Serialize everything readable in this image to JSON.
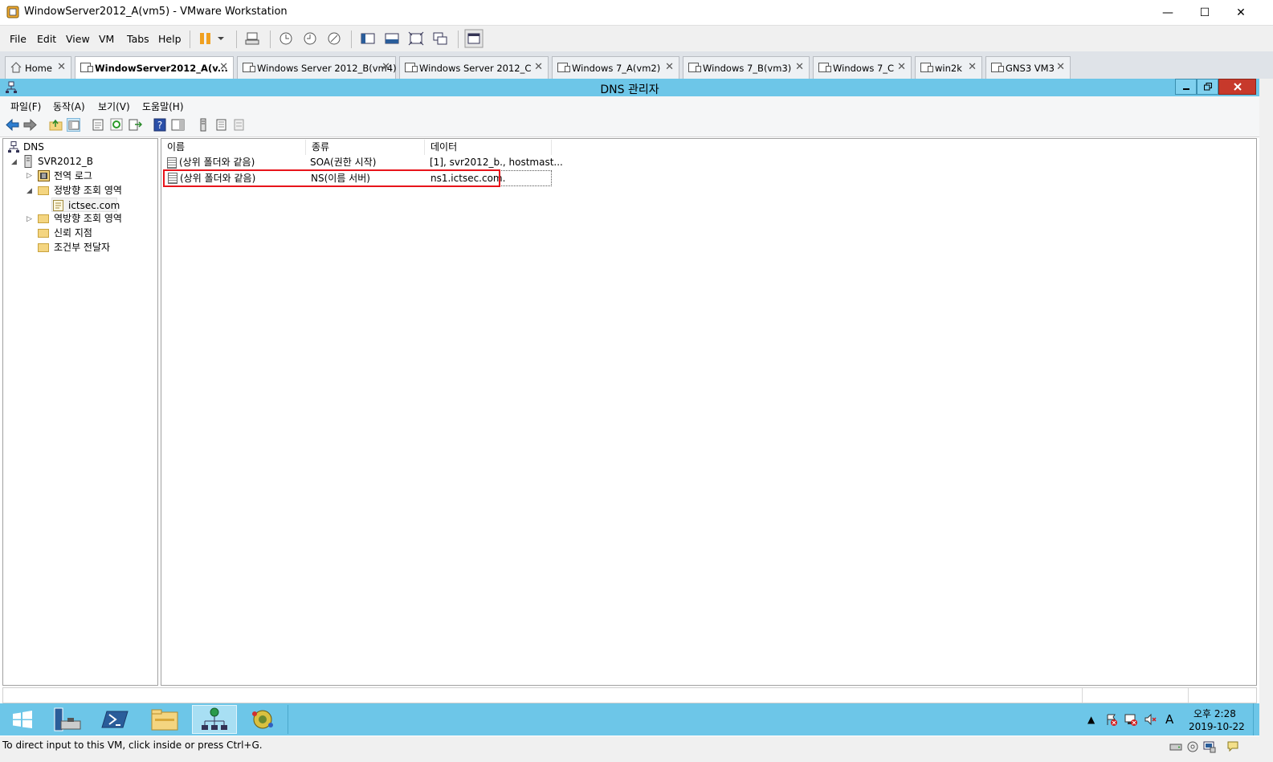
{
  "vmware": {
    "title": "WindowServer2012_A(vm5) - VMware Workstation",
    "window_controls": {
      "minimize": "—",
      "maximize": "☐",
      "close": "✕"
    },
    "menu": [
      "File",
      "Edit",
      "View",
      "VM",
      "Tabs",
      "Help"
    ],
    "tabs": [
      {
        "label": "Home",
        "icon": "home-icon"
      },
      {
        "label": "WindowServer2012_A(v...",
        "active": true
      },
      {
        "label": "Windows Server 2012_B(vm4)"
      },
      {
        "label": "Windows Server 2012_C"
      },
      {
        "label": "Windows 7_A(vm2)"
      },
      {
        "label": "Windows 7_B(vm3)"
      },
      {
        "label": "Windows 7_C"
      },
      {
        "label": "win2k"
      },
      {
        "label": "GNS3 VM3"
      }
    ],
    "tab_close": "✕",
    "status_text": "To direct input to this VM, click inside or press Ctrl+G."
  },
  "dns": {
    "title": "DNS 관리자",
    "menu": [
      "파일(F)",
      "동작(A)",
      "보기(V)",
      "도움말(H)"
    ],
    "tree": {
      "root": "DNS",
      "server": "SVR2012_B",
      "global_logs": "전역 로그",
      "forward_zones": "정방향 조회 영역",
      "zone": "ictsec.com",
      "reverse_zones": "역방향 조회 영역",
      "trust_points": "신뢰 지점",
      "conditional_forwarders": "조건부 전달자"
    },
    "columns": [
      "이름",
      "종류",
      "데이터"
    ],
    "records": [
      {
        "name": "(상위 폴더와 같음)",
        "type": "SOA(권한 시작)",
        "data": "[1], svr2012_b., hostmast..."
      },
      {
        "name": "(상위 폴더와 같음)",
        "type": "NS(이름 서버)",
        "data": "ns1.ictsec.com.",
        "highlighted": true
      }
    ],
    "highlight_color": "#e8141b"
  },
  "taskbar": {
    "clock_time": "오후 2:28",
    "clock_date": "2019-10-22",
    "ime": "A"
  }
}
